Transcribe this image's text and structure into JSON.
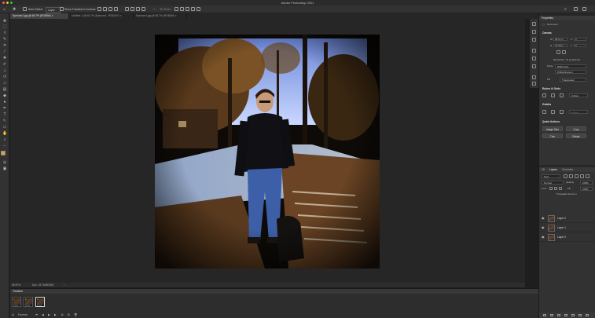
{
  "window": {
    "title": "Adobe Photoshop 2021"
  },
  "options_bar": {
    "auto_select_label": "Auto-Select:",
    "auto_select_value": "Layer",
    "show_transform_label": "Show Transform Controls",
    "mode_3d_label": "3D Mode:"
  },
  "tabs": [
    {
      "label": "Spencer1.jpg @ 66.7% (RGB/8#)",
      "active": true
    },
    {
      "label": "Untitled-1 @ 66.7% (Spencer1, RGB/16*)",
      "active": false
    },
    {
      "label": "Spencer1.jpg @ 66.7% (RGB/8#)",
      "active": false
    }
  ],
  "status_bar": {
    "zoom": "66.67%",
    "doc": "Doc: 23.7M/80.8M"
  },
  "timeline": {
    "title": "Timeline",
    "frames": [
      {
        "num": "1",
        "delay": "0 sec.",
        "selected": false
      },
      {
        "num": "2",
        "delay": "0 sec.",
        "selected": false
      },
      {
        "num": "3",
        "delay": "0 sec.",
        "selected": true
      }
    ],
    "loop": "Forever"
  },
  "properties": {
    "title": "Properties",
    "doc_label": "Document",
    "canvas": {
      "title": "Canvas",
      "w_label": "W",
      "w_value": "38.11 in",
      "h_label": "H",
      "h_value": "41.28 in",
      "x_label": "X",
      "x_value": "0",
      "y_label": "Y",
      "y_value": "0",
      "resolution": "Resolution: 72 pixels/inch",
      "mode_label": "Mode",
      "mode_value": "RGB Color",
      "bit_value": "8 Bits/Channel",
      "fill_label": "Fill",
      "fill_value": "Transparent"
    },
    "rulers": {
      "title": "Rulers & Grids",
      "unit": "Inches"
    },
    "guides": {
      "title": "Guides"
    },
    "quick_actions": {
      "title": "Quick Actions",
      "buttons": [
        "Image Size",
        "Crop",
        "Trim",
        "Rotate"
      ]
    }
  },
  "layers": {
    "tabs": [
      {
        "label": "3D",
        "active": false
      },
      {
        "label": "Layers",
        "active": true
      },
      {
        "label": "Channels",
        "active": false
      }
    ],
    "kind": "Kind",
    "blend": "Normal",
    "opacity_label": "Opacity",
    "opacity_value": "100%",
    "lock_label": "Lock",
    "fill_label": "Fill",
    "fill_value": "100%",
    "propagate_label": "Propagate Frame 1",
    "items": [
      "Layer 2",
      "Layer 1",
      "Layer 0"
    ]
  },
  "colors": {
    "bg": "#1e1e1e",
    "panel": "#323232",
    "accent": "#e0a040"
  }
}
